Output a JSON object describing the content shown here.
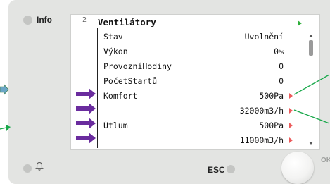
{
  "controls": {
    "info_label": "Info",
    "esc_label": "ESC",
    "ok_label": "OK",
    "alarm_icon": "bell-icon"
  },
  "screen": {
    "number": "2",
    "title": "Ventilátory",
    "rows": [
      {
        "label": "Stav",
        "value": "Uvolnění"
      },
      {
        "label": "Výkon",
        "value": "0%"
      },
      {
        "label": "ProvozníHodiny",
        "value": "0"
      },
      {
        "label": "PočetStartů",
        "value": "0"
      },
      {
        "label": "Komfort",
        "value": "500Pa"
      },
      {
        "label": "",
        "value": "32000m3/h"
      },
      {
        "label": "Útlum",
        "value": "500Pa"
      },
      {
        "label": "",
        "value": "11000m3/h"
      }
    ]
  },
  "colors": {
    "panel": "#e3e4e2",
    "annotation_arrow": "#6a2c9e",
    "annotation_line": "#18a84a",
    "edit_marker": "#ec5b5b",
    "nav_marker": "#2eae3a"
  }
}
